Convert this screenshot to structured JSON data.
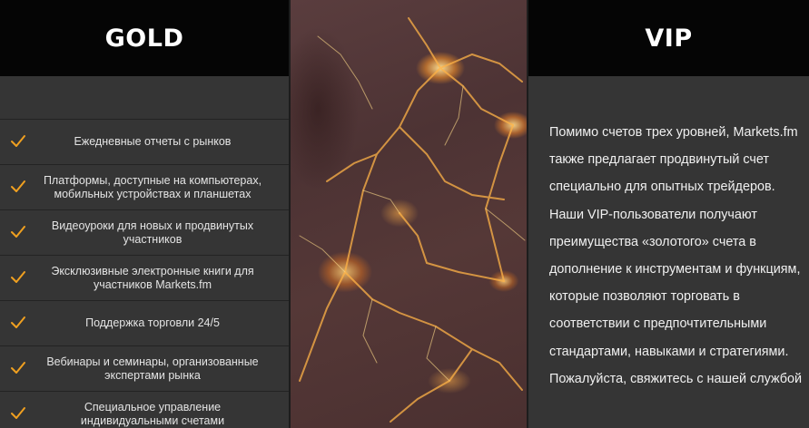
{
  "gold": {
    "title": "GOLD",
    "features": [
      {
        "text": "Ежедневные отчеты с рынков",
        "icon": "check-icon"
      },
      {
        "text": "Платформы, доступные на компьютерах, мобильных устройствах и планшетах",
        "icon": "check-icon"
      },
      {
        "text": "Видеоуроки для новых и продвинутых участников",
        "icon": "check-icon"
      },
      {
        "text": "Эксклюзивные электронные книги для участников Markets.fm",
        "icon": "check-icon"
      },
      {
        "text": "Поддержка торговли 24/5",
        "icon": "check-icon"
      },
      {
        "text": "Вебинары и семинары, организованные экспертами рынка",
        "icon": "check-icon"
      },
      {
        "text": "Специальное управление индивидуальными счетами",
        "icon": "check-icon"
      }
    ]
  },
  "vip": {
    "title": "VIP",
    "description": "Помимо счетов трех уровней, Markets.fm также предлагает продвинутый счет специально для опытных трейдеров. Наши VIP-пользователи получают преимущества «золотого» счета в дополнение к инструментам и функциям, которые позволяют торговать в соответствии с предпочтительными стандартами, навыками и стратегиями. Пожалуйста, свяжитесь с нашей службой"
  },
  "colors": {
    "header_bg": "#050505",
    "panel_bg": "#353535",
    "check_accent": "#f0a020",
    "text": "#e4e4e4"
  }
}
